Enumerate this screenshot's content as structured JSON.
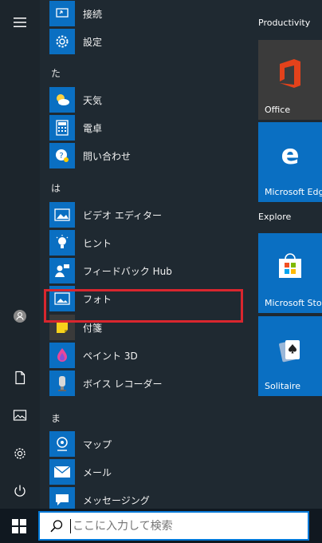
{
  "app_list": {
    "items_top": [
      {
        "label": "接続",
        "icon": "connect-icon"
      },
      {
        "label": "設定",
        "icon": "settings-gear-icon"
      }
    ],
    "section_ta": "た",
    "items_ta": [
      {
        "label": "天気",
        "icon": "weather-icon"
      },
      {
        "label": "電卓",
        "icon": "calculator-icon"
      },
      {
        "label": "問い合わせ",
        "icon": "get-help-icon"
      }
    ],
    "section_ha": "は",
    "items_ha": [
      {
        "label": "ビデオ エディター",
        "icon": "video-editor-icon"
      },
      {
        "label": "ヒント",
        "icon": "tips-icon"
      },
      {
        "label": "フィードバック Hub",
        "icon": "feedback-hub-icon"
      },
      {
        "label": "フォト",
        "icon": "photos-icon"
      },
      {
        "label": "付箋",
        "icon": "sticky-notes-icon"
      },
      {
        "label": "ペイント 3D",
        "icon": "paint3d-icon"
      },
      {
        "label": "ボイス レコーダー",
        "icon": "voice-recorder-icon"
      }
    ],
    "section_ma": "ま",
    "items_ma": [
      {
        "label": "マップ",
        "icon": "maps-icon"
      },
      {
        "label": "メール",
        "icon": "mail-icon"
      },
      {
        "label": "メッセージング",
        "icon": "messaging-icon"
      }
    ]
  },
  "tiles": {
    "group_productivity": "Productivity",
    "office": "Office",
    "edge": "Microsoft Edg",
    "group_explore": "Explore",
    "store": "Microsoft Sto",
    "solitaire": "Solitaire"
  },
  "taskbar": {
    "search_placeholder": "ここに入力して検索"
  },
  "colors": {
    "accent": "#0078d7",
    "tile_blue": "#0a6fc2",
    "highlight_red": "#d9262e"
  }
}
